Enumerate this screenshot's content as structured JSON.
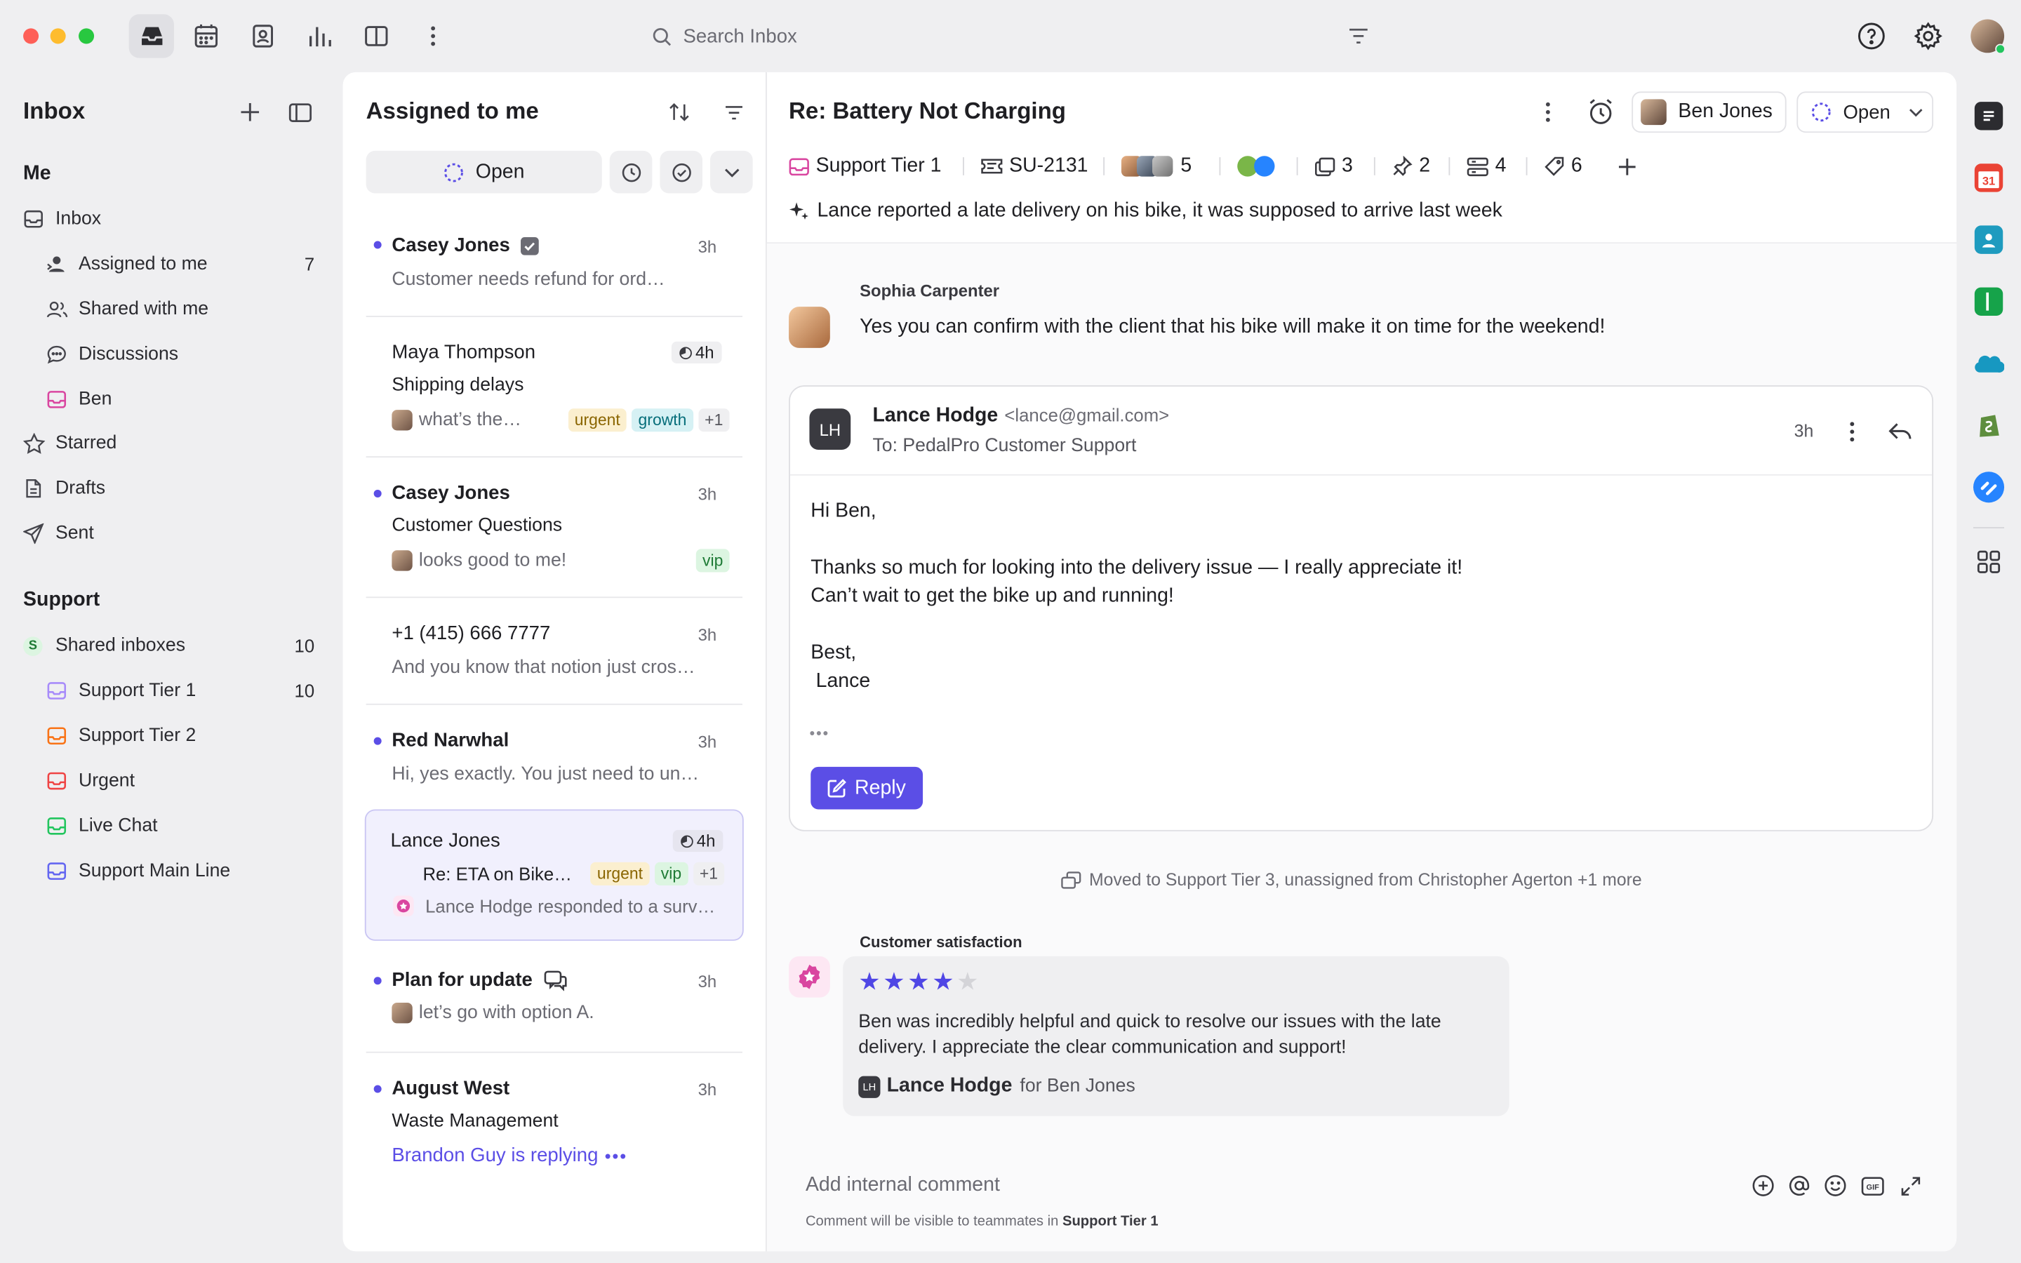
{
  "topbar": {
    "search_placeholder": "Search Inbox",
    "icons": [
      "inbox-icon",
      "calendar-icon",
      "contacts-icon",
      "analytics-icon",
      "split-view-icon",
      "more-vertical-icon",
      "filter-icon",
      "help-icon",
      "gear-icon",
      "user-avatar"
    ]
  },
  "sidebar": {
    "title": "Inbox",
    "me_title": "Me",
    "me_items": [
      {
        "label": "Inbox",
        "icon": "inbox-icon"
      },
      {
        "label": "Assigned to me",
        "icon": "assigned-user-icon",
        "count": "7"
      },
      {
        "label": "Shared with me",
        "icon": "shared-users-icon"
      },
      {
        "label": "Discussions",
        "icon": "chat-bubble-icon"
      },
      {
        "label": "Ben",
        "icon": "inbox-icon"
      },
      {
        "label": "Starred",
        "icon": "star-icon"
      },
      {
        "label": "Drafts",
        "icon": "draft-icon"
      },
      {
        "label": "Sent",
        "icon": "send-icon"
      }
    ],
    "support_title": "Support",
    "support_items": [
      {
        "label": "Shared inboxes",
        "icon": "S",
        "count": "10"
      },
      {
        "label": "Support Tier 1",
        "count": "10",
        "color": "#a78bfa"
      },
      {
        "label": "Support Tier 2",
        "color": "#f97316"
      },
      {
        "label": "Urgent",
        "color": "#ef4444"
      },
      {
        "label": "Live Chat",
        "color": "#22c55e"
      },
      {
        "label": "Support Main Line",
        "color": "#6366f1"
      }
    ]
  },
  "list": {
    "title": "Assigned to me",
    "status_filter": "Open",
    "conversations": [
      {
        "name": "Casey Jones",
        "time": "3h",
        "preview": "Customer needs refund for ord…",
        "unread": true
      },
      {
        "name": "Maya Thompson",
        "time": "4h",
        "subject": "Shipping delays",
        "preview": "what’s the…",
        "tags": [
          "urgent",
          "growth",
          "+1"
        ]
      },
      {
        "name": "Casey Jones",
        "time": "3h",
        "subject": "Customer Questions",
        "preview": "looks good to me!",
        "tags": [
          "vip"
        ],
        "unread": true
      },
      {
        "name": "+1 (415) 666 7777",
        "time": "3h",
        "preview": "And you know that notion just cros…"
      },
      {
        "name": "Red Narwhal",
        "time": "3h",
        "preview": "Hi, yes exactly. You just need to un…",
        "unread": true
      },
      {
        "name": "Lance Jones",
        "time": "4h",
        "subject": "Re: ETA on Bike…",
        "preview": "Lance Hodge responded to a surv…",
        "tags": [
          "urgent",
          "vip",
          "+1"
        ],
        "selected": true
      },
      {
        "name": "Plan for update",
        "time": "3h",
        "preview": "let’s go with option A.",
        "unread": true
      },
      {
        "name": "August West",
        "time": "3h",
        "subject": "Waste Management",
        "preview": "Brandon Guy is replying",
        "unread": true
      }
    ]
  },
  "conversation": {
    "subject": "Re: Battery Not Charging",
    "assignee": "Ben Jones",
    "status": "Open",
    "meta": {
      "inbox": "Support Tier 1",
      "ticket": "SU-2131",
      "followers": "5",
      "linked": "3",
      "pins": "2",
      "fields": "4",
      "tags": "6"
    },
    "ai_summary": "Lance reported a late delivery on his bike, it was supposed to arrive last week",
    "comment": {
      "author": "Sophia Carpenter",
      "text": "Yes you can confirm with the client that his bike will make it on time for the weekend!"
    },
    "email": {
      "initials": "LH",
      "from_name": "Lance Hodge",
      "from_email": "<lance@gmail.com>",
      "to": "To: PedalPro Customer Support",
      "time": "3h",
      "greeting": "Hi Ben,",
      "line1": "Thanks so much for looking into the delivery issue — I really appreciate it!",
      "line2": "Can’t wait to get the bike up and running!",
      "signoff": "Best,",
      "signature": "Lance",
      "reply_label": "Reply"
    },
    "activity": "Moved to Support Tier 3, unassigned from Christopher Agerton +1 more",
    "csat": {
      "title": "Customer satisfaction",
      "rating": 4,
      "max": 5,
      "text": "Ben was incredibly helpful and quick to resolve our issues with the late delivery. I appreciate the clear communication and support!",
      "initials": "LH",
      "author": "Lance Hodge",
      "for": "for Ben Jones"
    },
    "composer": {
      "placeholder": "Add internal comment",
      "hint_prefix": "Comment will be visible to teammates in ",
      "hint_inbox": "Support Tier 1"
    }
  },
  "right_rail": [
    "notes-icon",
    "calendar-31-icon",
    "contact-card-icon",
    "green-book-icon",
    "salesforce-icon",
    "shopify-icon",
    "jira-icon",
    "apps-grid-icon"
  ],
  "colors": {
    "accent": "#5b4ee6",
    "panel": "#ffffff",
    "background": "#efeff1"
  }
}
